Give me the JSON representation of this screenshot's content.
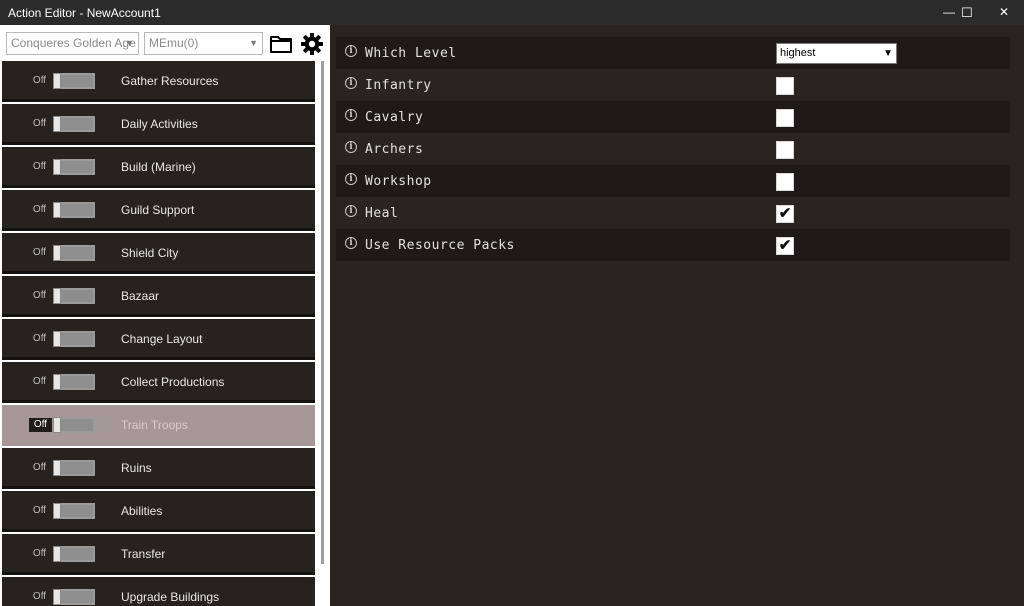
{
  "window": {
    "title": "Action Editor - NewAccount1",
    "minimize": "—",
    "maximize": "☐",
    "close": "✕"
  },
  "toolbar": {
    "game_combo": "Conqueres Golden Age",
    "emulator_combo": "MEmu(0)"
  },
  "actions": [
    {
      "state": "Off",
      "label": "Gather Resources"
    },
    {
      "state": "Off",
      "label": "Daily Activities"
    },
    {
      "state": "Off",
      "label": "Build (Marine)"
    },
    {
      "state": "Off",
      "label": "Guild Support"
    },
    {
      "state": "Off",
      "label": "Shield City"
    },
    {
      "state": "Off",
      "label": "Bazaar"
    },
    {
      "state": "Off",
      "label": "Change Layout"
    },
    {
      "state": "Off",
      "label": "Collect Productions"
    },
    {
      "state": "Off",
      "label": "Train Troops",
      "selected": true
    },
    {
      "state": "Off",
      "label": "Ruins"
    },
    {
      "state": "Off",
      "label": "Abilities"
    },
    {
      "state": "Off",
      "label": "Transfer"
    },
    {
      "state": "Off",
      "label": "Upgrade Buildings"
    }
  ],
  "options": [
    {
      "label": "Which Level",
      "type": "select",
      "value": "highest"
    },
    {
      "label": "Infantry",
      "type": "checkbox",
      "checked": false
    },
    {
      "label": "Cavalry",
      "type": "checkbox",
      "checked": false
    },
    {
      "label": "Archers",
      "type": "checkbox",
      "checked": false
    },
    {
      "label": "Workshop",
      "type": "checkbox",
      "checked": false
    },
    {
      "label": "Heal",
      "type": "checkbox",
      "checked": true
    },
    {
      "label": "Use Resource Packs",
      "type": "checkbox",
      "checked": true
    }
  ],
  "icons": {
    "folder": "folder-icon",
    "settings": "gear-icon",
    "info": "info-icon"
  },
  "colors": {
    "selected_item": "#a69898",
    "item_bg": "#262220",
    "panel_bg": "#272422"
  }
}
